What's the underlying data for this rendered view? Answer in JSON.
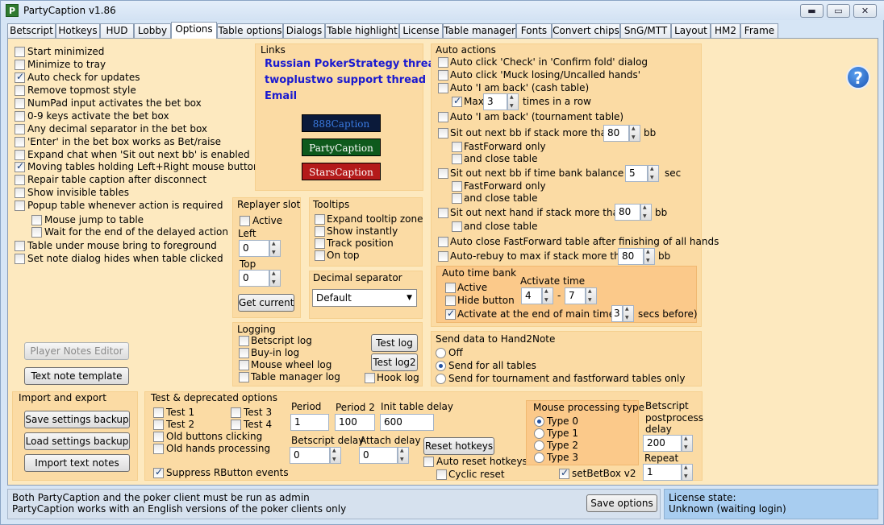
{
  "window": {
    "title": "PartyCaption v1.86",
    "icon_letter": "P"
  },
  "tabs": [
    "Betscript",
    "Hotkeys",
    "HUD",
    "Lobby",
    "Options",
    "Table options",
    "Dialogs",
    "Table highlight",
    "License",
    "Table manager",
    "Fonts",
    "Convert chips",
    "SnG/MTT",
    "Layout",
    "HM2",
    "Frame"
  ],
  "general": {
    "items": [
      {
        "label": "Start minimized",
        "checked": false
      },
      {
        "label": "Minimize to tray",
        "checked": false
      },
      {
        "label": "Auto check for updates",
        "checked": true
      },
      {
        "label": "Remove topmost style",
        "checked": false
      },
      {
        "label": "NumPad input activates the bet box",
        "checked": false
      },
      {
        "label": "0-9 keys activate the bet box",
        "checked": false
      },
      {
        "label": "Any decimal separator in the bet box",
        "checked": false
      },
      {
        "label": "'Enter' in the bet box works as Bet/raise",
        "checked": false
      },
      {
        "label": "Expand chat when 'Sit out next bb' is enabled",
        "checked": false
      },
      {
        "label": "Moving tables holding Left+Right mouse buttons",
        "checked": true
      },
      {
        "label": "Repair table caption after disconnect",
        "checked": false
      },
      {
        "label": "Show invisible tables",
        "checked": false
      },
      {
        "label": "Popup table whenever action is required",
        "checked": false
      }
    ],
    "sub_items": [
      {
        "label": "Mouse jump to table",
        "checked": false
      },
      {
        "label": "Wait for the end of the delayed action",
        "checked": false
      }
    ],
    "items2": [
      {
        "label": "Table under mouse bring to foreground",
        "checked": false
      },
      {
        "label": "Set note dialog hides when table clicked",
        "checked": false
      }
    ],
    "player_notes_editor": "Player Notes Editor",
    "text_note_template": "Text note template"
  },
  "links": {
    "title": "Links",
    "items": [
      "Russian PokerStrategy thread",
      "twoplustwo support thread",
      "Email"
    ],
    "badges": [
      {
        "label": "888Caption",
        "bg": "#0b1a3a",
        "fg": "#3a7ae0"
      },
      {
        "label": "PartyCaption",
        "bg": "#0e5a1c",
        "fg": "#ffffff"
      },
      {
        "label": "StarsCaption",
        "bg": "#b41a1a",
        "fg": "#ffffff"
      }
    ]
  },
  "replayer": {
    "title": "Replayer slot",
    "active_label": "Active",
    "left_label": "Left",
    "left_value": "0",
    "top_label": "Top",
    "top_value": "0",
    "get_current": "Get current"
  },
  "tooltips": {
    "title": "Tooltips",
    "items": [
      "Expand tooltip zone",
      "Show instantly",
      "Track position",
      "On top"
    ]
  },
  "decimal": {
    "title": "Decimal separator",
    "value": "Default"
  },
  "logging": {
    "title": "Logging",
    "items": [
      "Betscript log",
      "Buy-in log",
      "Mouse wheel log",
      "Table manager log"
    ],
    "test_log": "Test log",
    "test_log2": "Test log2",
    "hook_log": "Hook log"
  },
  "auto_actions": {
    "title": "Auto actions",
    "click_check": "Auto click 'Check' in 'Confirm fold' dialog",
    "click_muck": "Auto click 'Muck losing/Uncalled hands'",
    "iamback_cash": "Auto 'I am back' (cash table)",
    "max_label": "Max",
    "max_value": "3",
    "times_label": "times in a row",
    "iamback_tourn": "Auto 'I am back' (tournament table)",
    "sitout_bb": "Sit out next bb if stack more than",
    "sitout_bb_value": "80",
    "bb": "bb",
    "ff_only": "FastForward only",
    "close_table": "and close table",
    "sitout_time": "Sit out next bb if time bank balance <",
    "sitout_time_value": "5",
    "sec": "sec",
    "sitout_hand": "Sit out next hand if stack more than",
    "sitout_hand_value": "80",
    "auto_close_ff": "Auto close FastForward table after finishing of all hands",
    "rebuy": "Auto-rebuy to max if stack more than",
    "rebuy_value": "80"
  },
  "time_bank": {
    "title": "Auto time bank",
    "active": "Active",
    "hide_button": "Hide button",
    "activate_time": "Activate time",
    "from": "4",
    "dash": "-",
    "to": "7",
    "at_end": "Activate at the end of main time (",
    "at_end_value": "3",
    "secs_before": "secs before)"
  },
  "h2n": {
    "title": "Send data to Hand2Note",
    "options": [
      "Off",
      "Send for all tables",
      "Send for tournament and fastforward tables only"
    ],
    "selected": 1
  },
  "import_export": {
    "title": "Import and export",
    "buttons": [
      "Save settings backup",
      "Load settings backup",
      "Import text notes"
    ]
  },
  "test": {
    "title": "Test & deprecated options",
    "tests": [
      "Test 1",
      "Test 2",
      "Test 3",
      "Test 4"
    ],
    "old_buttons": "Old buttons clicking",
    "old_hands": "Old hands processing",
    "suppress": "Suppress RButton events",
    "period_label": "Period",
    "period": "1",
    "period2_label": "Period 2",
    "period2": "100",
    "init_delay_label": "Init table delay",
    "init_delay": "600",
    "betscript_delay_label": "Betscript delay",
    "betscript_delay": "0",
    "attach_delay_label": "Attach delay",
    "attach_delay": "0",
    "reset_hotkeys": "Reset hotkeys",
    "auto_reset": "Auto reset hotkeys",
    "cyclic_reset": "Cyclic reset"
  },
  "mouse": {
    "title": "Mouse processing type",
    "types": [
      "Type 0",
      "Type 1",
      "Type 2",
      "Type 3"
    ],
    "selected": 0,
    "setbetbox": "setBetBox v2"
  },
  "betscript_pp": {
    "label1": "Betscript",
    "label2": "postprocess",
    "label3": "delay",
    "value": "200",
    "repeat_label": "Repeat",
    "repeat_value": "1"
  },
  "status": {
    "line1": "Both PartyCaption and the poker client must be run as admin",
    "line2": "PartyCaption works with an English versions of the poker clients only",
    "save": "Save options"
  },
  "license": {
    "label": "License state:",
    "value": "Unknown (waiting login)"
  }
}
